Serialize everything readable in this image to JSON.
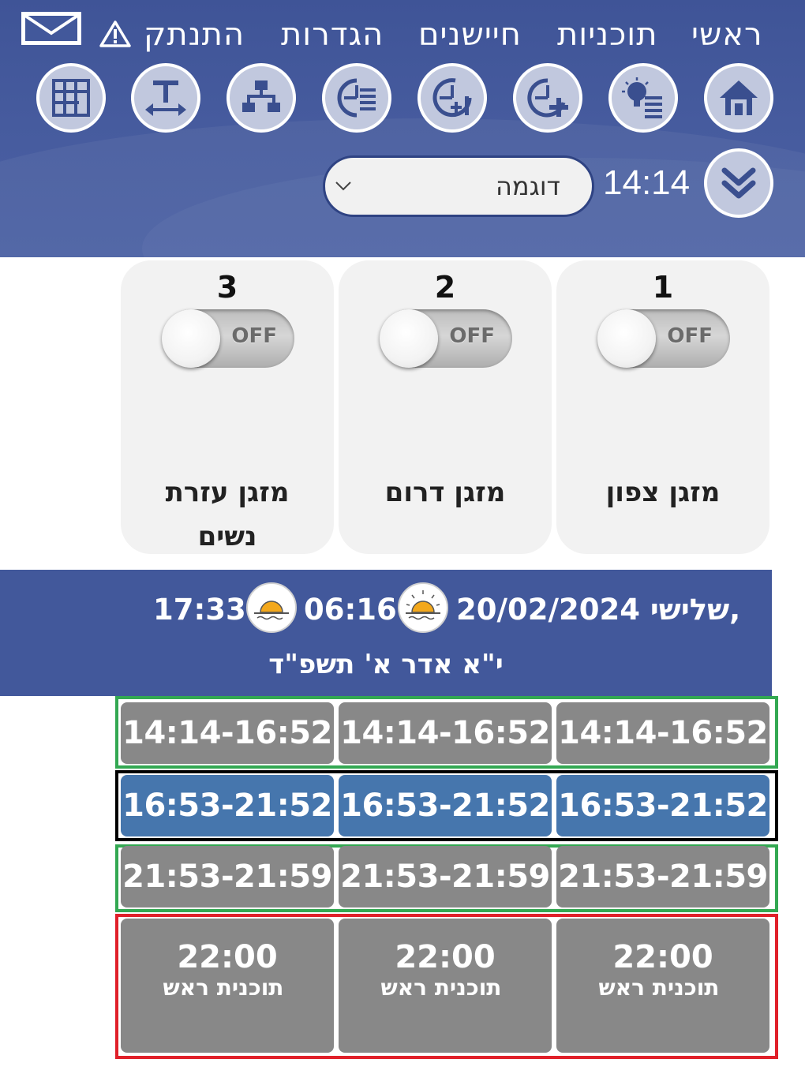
{
  "menu": {
    "items": [
      "ראשי",
      "תוכניות",
      "חיישנים",
      "הגדרות",
      "התנתק"
    ]
  },
  "toolbar": {
    "icons": [
      "home-icon",
      "scenes-icon",
      "add-timer-icon",
      "timer-plus-one-icon",
      "timer-list-icon",
      "network-icon",
      "resize-width-icon",
      "grid-icon"
    ]
  },
  "status": {
    "time": "14:14",
    "selected_program": "דוגמה"
  },
  "devices": [
    {
      "number": "1",
      "name": "מזגן צפון",
      "state": "OFF"
    },
    {
      "number": "2",
      "name": "מזגן דרום",
      "state": "OFF"
    },
    {
      "number": "3",
      "name": "מזגן עזרת נשים",
      "state": "OFF"
    }
  ],
  "date_info": {
    "date_text": "20/02/2024 שלישי,",
    "sunrise": "06:16↑",
    "sunset": "17:33↓",
    "hebrew_date": "י\"א אדר א' תשפ\"ד"
  },
  "schedule": {
    "row1": [
      "14:14-16:52",
      "14:14-16:52",
      "14:14-16:52"
    ],
    "row2": [
      "16:53-21:52",
      "16:53-21:52",
      "16:53-21:52"
    ],
    "row3": [
      "21:53-21:59",
      "21:53-21:59",
      "21:53-21:59"
    ],
    "row4": [
      {
        "time": "22:00",
        "label": "תוכנית ראש"
      },
      {
        "time": "22:00",
        "label": "תוכנית ראש"
      },
      {
        "time": "22:00",
        "label": "תוכנית ראש"
      }
    ]
  },
  "colors": {
    "header_bg": "#42589b",
    "active_slot": "#4676ad",
    "slot": "#888888",
    "frame_green": "#33a852",
    "frame_red": "#e0202a"
  }
}
